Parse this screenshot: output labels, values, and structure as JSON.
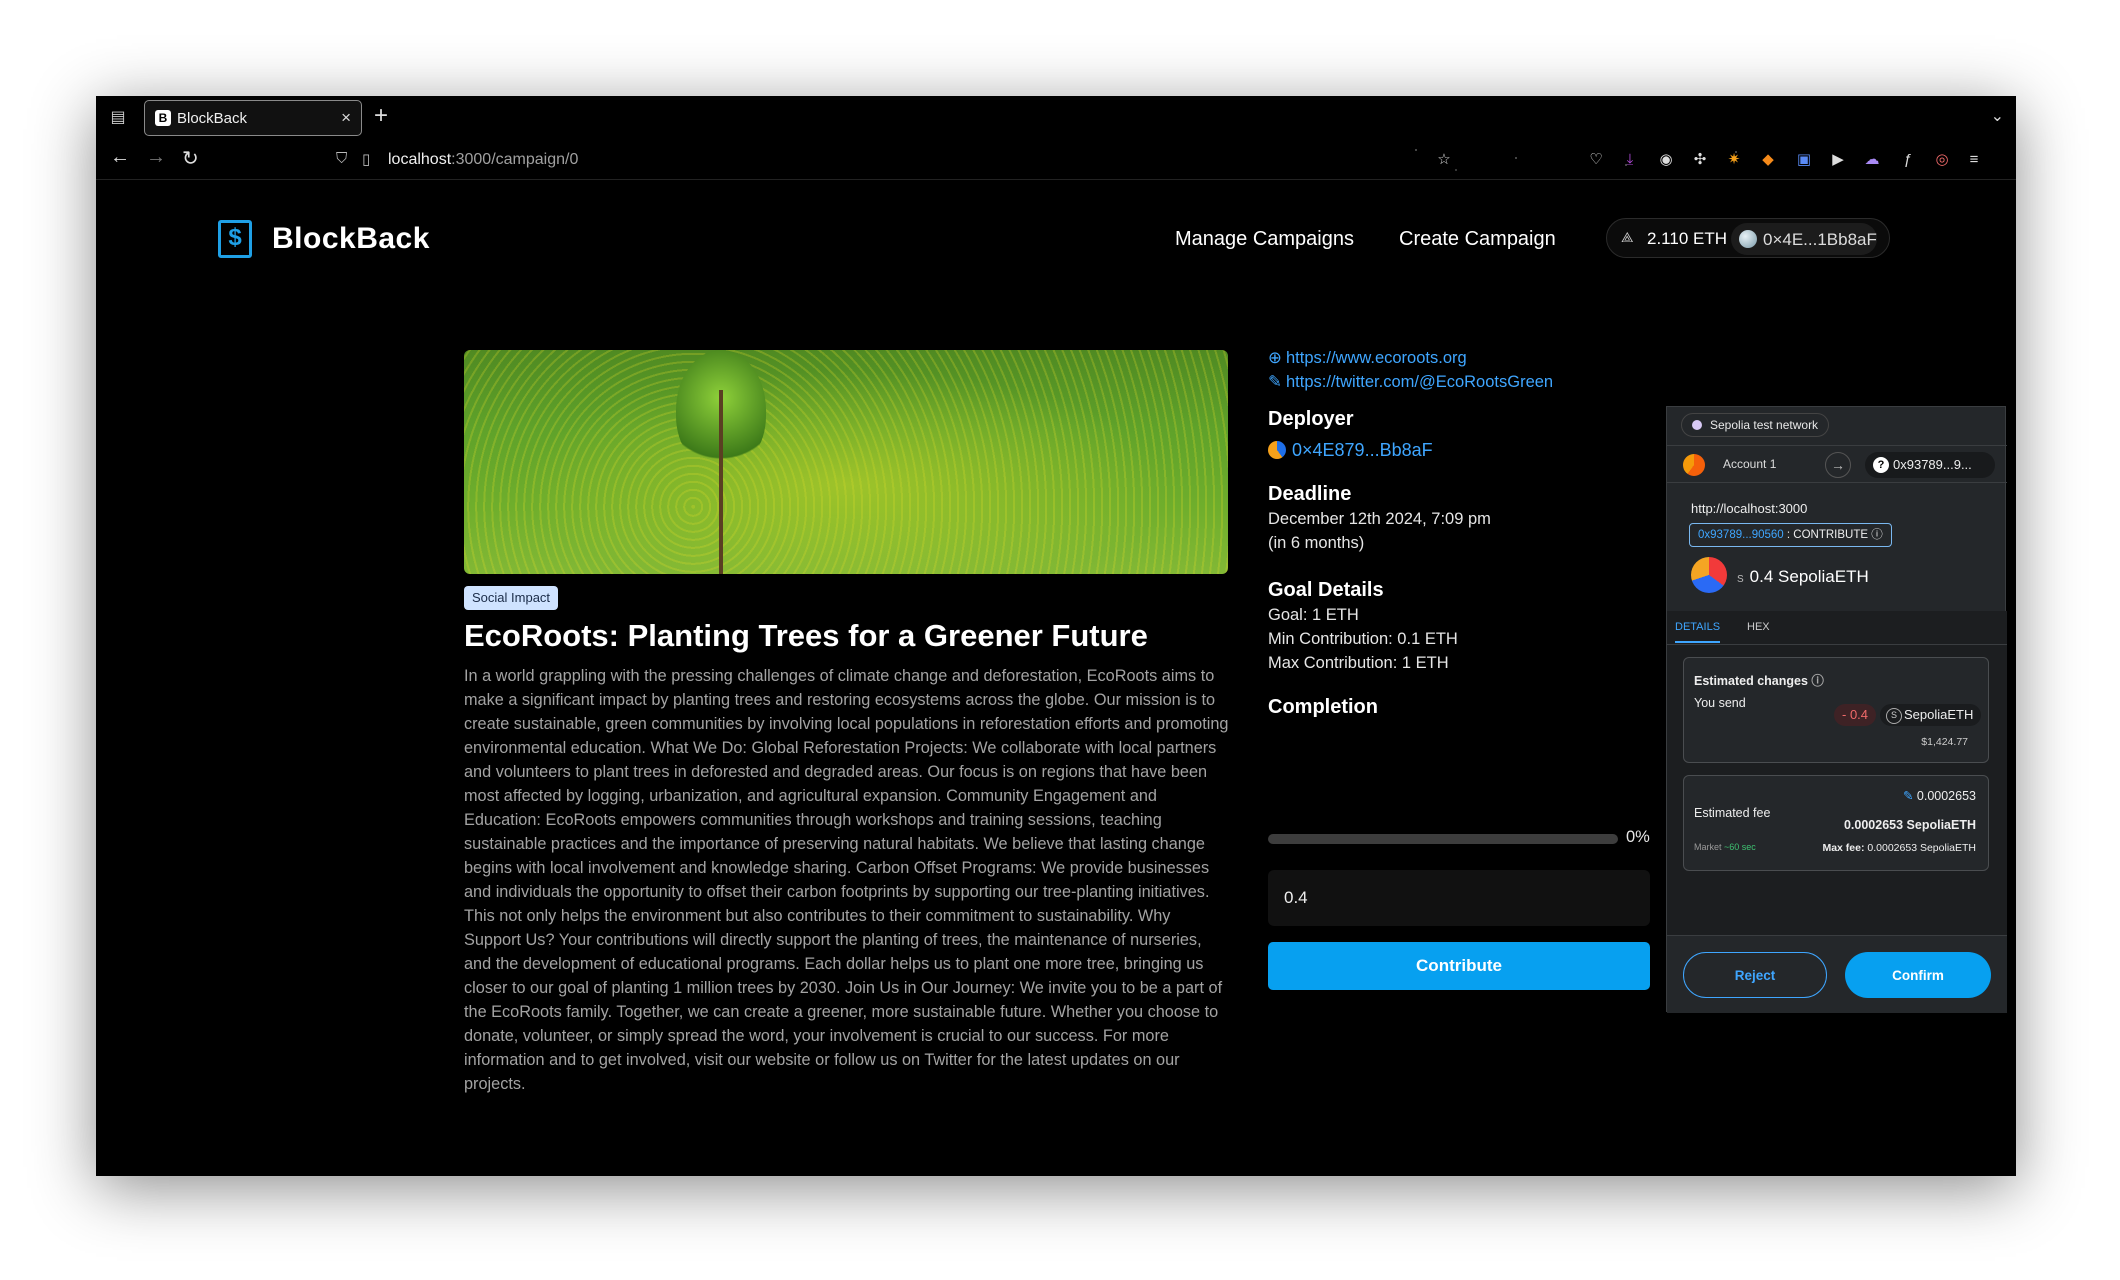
{
  "browser": {
    "tab_title": "BlockBack",
    "tab_favicon": "B",
    "url_host": "localhost",
    "url_path": ":3000/campaign/0"
  },
  "header": {
    "brand": "BlockBack",
    "nav": [
      "Manage Campaigns",
      "Create Campaign"
    ],
    "balance": "2.110 ETH",
    "address": "0×4E...1Bb8aF"
  },
  "campaign": {
    "tag": "Social Impact",
    "title": "EcoRoots: Planting Trees for a Greener Future",
    "description": "In a world grappling with the pressing challenges of climate change and deforestation, EcoRoots aims to make a significant impact by planting trees and restoring ecosystems across the globe. Our mission is to create sustainable, green communities by involving local populations in reforestation efforts and promoting environmental education. What We Do: Global Reforestation Projects: We collaborate with local partners and volunteers to plant trees in deforested and degraded areas. Our focus is on regions that have been most affected by logging, urbanization, and agricultural expansion. Community Engagement and Education: EcoRoots empowers communities through workshops and training sessions, teaching sustainable practices and the importance of preserving natural habitats. We believe that lasting change begins with local involvement and knowledge sharing. Carbon Offset Programs: We provide businesses and individuals the opportunity to offset their carbon footprints by supporting our tree-planting initiatives. This not only helps the environment but also contributes to their commitment to sustainability. Why Support Us? Your contributions will directly support the planting of trees, the maintenance of nurseries, and the development of educational programs. Each dollar helps us to plant one more tree, bringing us closer to our goal of planting 1 million trees by 2030. Join Us in Our Journey: We invite you to be a part of the EcoRoots family. Together, we can create a greener, more sustainable future. Whether you choose to donate, volunteer, or simply spread the word, your involvement is crucial to our success. For more information and to get involved, visit our website or follow us on Twitter for the latest updates on our projects.",
    "website": "https://www.ecoroots.org",
    "twitter": "https://twitter.com/@EcoRootsGreen",
    "deployer_heading": "Deployer",
    "deployer": "0×4E879...Bb8aF",
    "deadline_heading": "Deadline",
    "deadline": "December 12th 2024, 7:09 pm",
    "deadline_relative": "(in 6 months)",
    "goal_heading": "Goal Details",
    "goal": "Goal: 1 ETH",
    "min_contribution": "Min Contribution: 0.1 ETH",
    "max_contribution": "Max Contribution: 1 ETH",
    "completion_heading": "Completion",
    "completion_fraction": 0,
    "completion_label": "0%",
    "amount_value": "0.4",
    "contribute_label": "Contribute"
  },
  "metamask": {
    "network": "Sepolia test network",
    "account": "Account 1",
    "to_address": "0x93789...9...",
    "origin": "http://localhost:3000",
    "method_address": "0x93789...90560",
    "method_label": ": CONTRIBUTE",
    "amount_prefix": "S",
    "amount": "0.4 SepoliaETH",
    "tab_details": "DETAILS",
    "tab_hex": "HEX",
    "est_changes_label": "Estimated changes",
    "you_send_label": "You send",
    "send_amount": "- 0.4",
    "send_symbol": "SepoliaETH",
    "send_fiat": "$1,424.77",
    "est_fee_label": "Estimated fee",
    "fee_short": "0.0002653",
    "fee_full": "0.0002653 SepoliaETH",
    "market_label": "Market",
    "market_time": "~60 sec",
    "max_fee_label": "Max fee:",
    "max_fee": "0.0002653 SepoliaETH",
    "reject_label": "Reject",
    "confirm_label": "Confirm"
  },
  "colors": {
    "accent": "#07a0f0",
    "link": "#3fa6ff",
    "background": "#000000"
  }
}
